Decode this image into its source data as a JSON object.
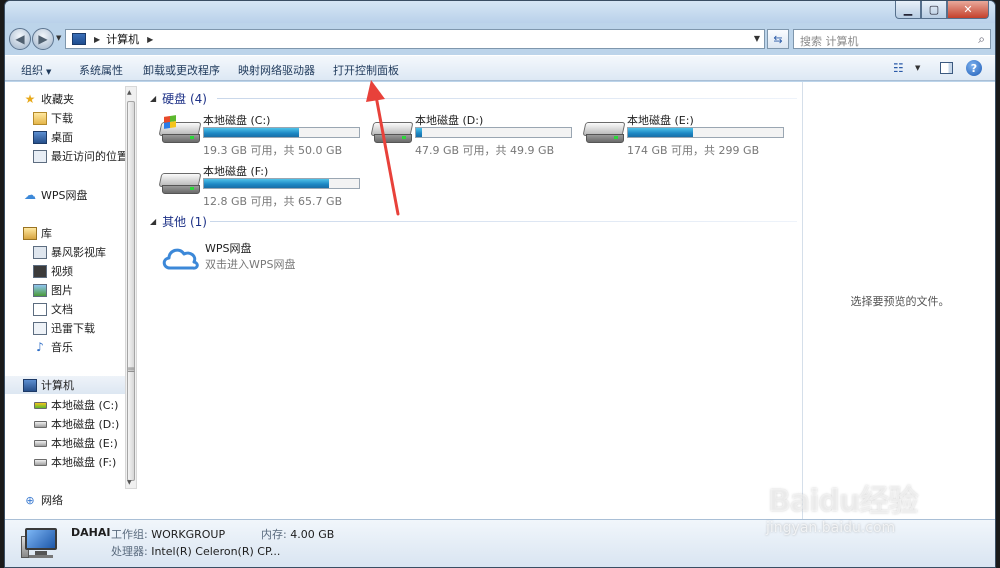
{
  "window": {
    "caption": {
      "minimize": "▁",
      "maximize": "▢",
      "close": "✕"
    }
  },
  "navbar": {
    "back": "◀",
    "forward": "▶",
    "address": [
      "计算机"
    ],
    "search_placeholder": "搜索 计算机"
  },
  "commands": {
    "organize": "组织",
    "system_properties": "系统属性",
    "uninstall": "卸载或更改程序",
    "map_drive": "映射网络驱动器",
    "control_panel": "打开控制面板"
  },
  "sidebar": {
    "favorites": "收藏夹",
    "downloads": "下载",
    "desktop": "桌面",
    "recent": "最近访问的位置",
    "wps": "WPS网盘",
    "libraries": "库",
    "baofeng": "暴风影视库",
    "videos": "视频",
    "pictures": "图片",
    "documents": "文档",
    "xunlei": "迅雷下载",
    "music": "音乐",
    "computer": "计算机",
    "drive_c": "本地磁盘 (C:)",
    "drive_d": "本地磁盘 (D:)",
    "drive_e": "本地磁盘 (E:)",
    "drive_f": "本地磁盘 (F:)",
    "network": "网络"
  },
  "groups": {
    "hard_disks": "硬盘 (4)",
    "other": "其他 (1)"
  },
  "drives": [
    {
      "name": "本地磁盘 (C:)",
      "free": "19.3 GB 可用，共 50.0 GB",
      "used_fraction": 0.614
    },
    {
      "name": "本地磁盘 (D:)",
      "free": "47.9 GB 可用，共 49.9 GB",
      "used_fraction": 0.04
    },
    {
      "name": "本地磁盘 (E:)",
      "free": "174 GB 可用，共 299 GB",
      "used_fraction": 0.418
    },
    {
      "name": "本地磁盘 (F:)",
      "free": "12.8 GB 可用，共 65.7 GB",
      "used_fraction": 0.805
    }
  ],
  "other_item": {
    "name": "WPS网盘",
    "desc": "双击进入WPS网盘"
  },
  "preview": {
    "message": "选择要预览的文件。"
  },
  "details": {
    "pc_name": "DAHAI",
    "workgroup_label": "工作组:",
    "workgroup_value": "WORKGROUP",
    "memory_label": "内存:",
    "memory_value": "4.00 GB",
    "cpu_label": "处理器:",
    "cpu_value": "Intel(R) Celeron(R) CP..."
  },
  "watermark": {
    "logo": "Baidu经验",
    "url": "jingyan.baidu.com"
  },
  "colors": {
    "arrow": "#e8413a",
    "bar_fill": "#1c86c3",
    "group_head": "#1e3287"
  }
}
